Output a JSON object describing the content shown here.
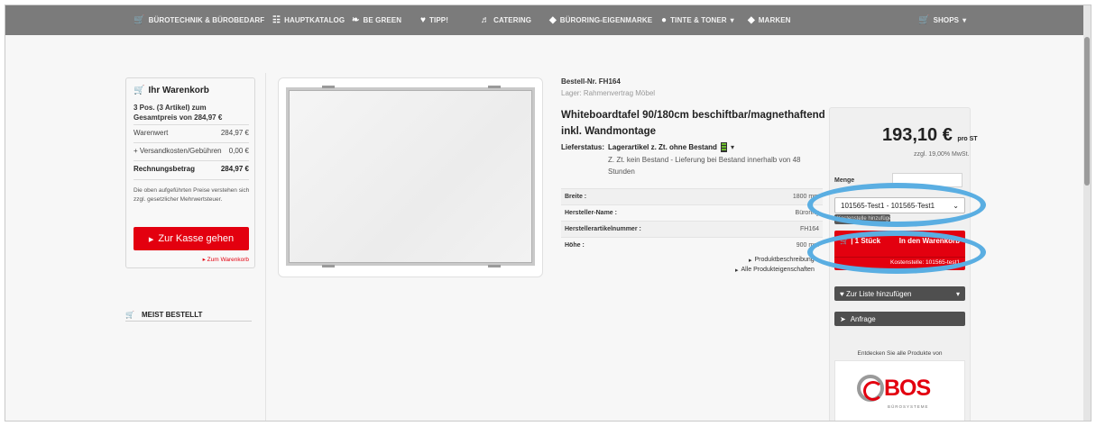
{
  "nav": {
    "items": [
      {
        "label": "BÜROTECHNIK & BÜROBEDARF",
        "icon": "cart-icon"
      },
      {
        "label": "HAUPTKATALOG",
        "icon": "sitemap-icon"
      },
      {
        "label": "BE GREEN",
        "icon": "leaf-icon"
      },
      {
        "label": "TIPP!",
        "icon": "heart-icon"
      },
      {
        "label": "CATERING",
        "icon": "glass-icon"
      },
      {
        "label": "BÜRORING-EIGENMARKE",
        "icon": "tag-icon"
      },
      {
        "label": "TINTE & TONER",
        "icon": "drop-icon"
      },
      {
        "label": "MARKEN",
        "icon": "tags-icon"
      },
      {
        "label": "SHOPS",
        "icon": "cart-icon"
      }
    ]
  },
  "cart": {
    "title": "Ihr Warenkorb",
    "summary": "3 Pos. (3 Artikel) zum Gesamtpreis von 284,97 €",
    "rows": [
      {
        "label": "Warenwert",
        "value": "284,97 €"
      },
      {
        "label": "+ Versandkosten/Gebühren",
        "value": "0,00 €"
      },
      {
        "label": "Rechnungsbetrag",
        "value": "284,97 €"
      }
    ],
    "note": "Die oben aufgeführten Preise verstehen sich zzgl. gesetzlicher Mehrwertsteuer.",
    "checkout_label": "Zur Kasse gehen",
    "cart_link": "Zum Warenkorb"
  },
  "bestseller": {
    "title": "MEIST BESTELLT"
  },
  "product": {
    "order_nr": "Bestell-Nr. FH164",
    "store": "Lager: Rahmenvertrag Möbel",
    "title": "Whiteboardtafel 90/180cm beschiftbar/magnethaftend inkl. Wandmontage",
    "stock_label": "Lieferstatus:",
    "stock_value": "Lagerartikel z. Zt. ohne Bestand",
    "stock_desc": "Z. Zt. kein Bestand - Lieferung bei Bestand innerhalb von 48 Stunden",
    "attributes": [
      {
        "key": "Breite :",
        "value": "1800 mm"
      },
      {
        "key": "Hersteller-Name :",
        "value": "Büroring"
      },
      {
        "key": "Herstellerartikelnummer :",
        "value": "FH164"
      },
      {
        "key": "Höhe :",
        "value": "900 mm"
      }
    ],
    "desc_link": "Produktbeschreibung",
    "props_link": "Alle Produkteigenschaften"
  },
  "buy": {
    "price": "193,10 €",
    "price_unit": "pro ST",
    "vat": "zzgl. 19,00% MwSt.",
    "qty_label": "Menge",
    "cost_center_select": "101565-Test1 - 101565-Test1",
    "add_cost_center": "Kostenstelle hinzufügen",
    "cart_qty": "1 Stück",
    "cart_label": "In den Warenkorb",
    "cost_center_info": "Kostenstelle: 101565-test1",
    "list_label": "Zur Liste hinzufügen",
    "request_label": "Anfrage",
    "discover": "Entdecken Sie alle Produkte von",
    "brand": "BOS",
    "brand_sub": "BÜROSYSTEME"
  },
  "colors": {
    "accent": "#e3000f",
    "nav": "#7b7b7b",
    "annotation": "#5aaee2"
  }
}
